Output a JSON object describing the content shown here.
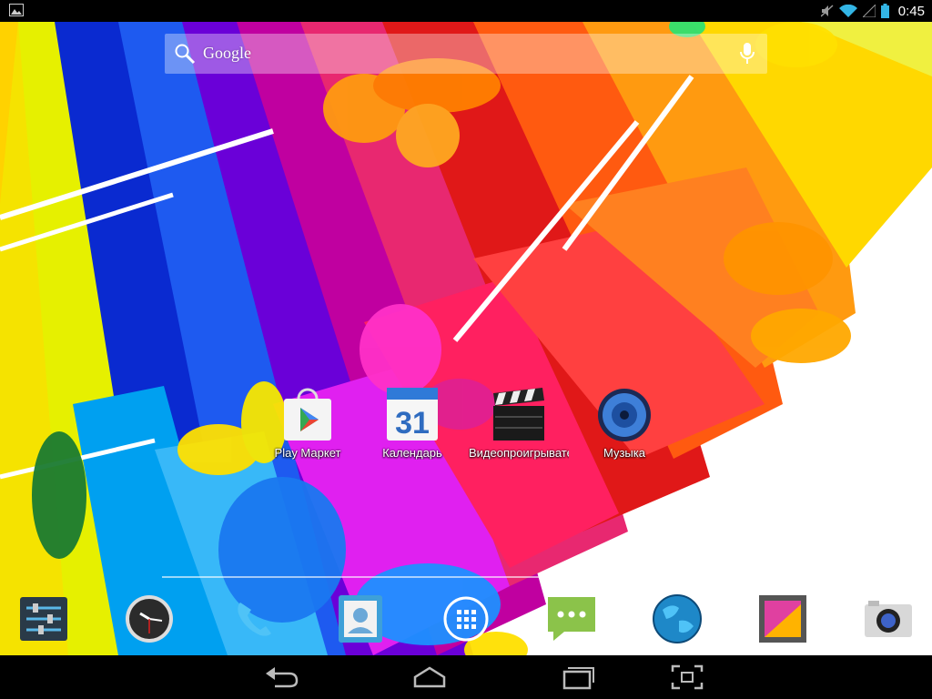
{
  "status_bar": {
    "time": "0:45",
    "icons": [
      "image-notification-icon",
      "mute-icon",
      "wifi-icon",
      "signal-icon",
      "battery-icon"
    ]
  },
  "search": {
    "placeholder": "Google",
    "icon": "search-icon",
    "voice_icon": "mic-icon"
  },
  "home_apps": [
    {
      "label": "Play Маркет",
      "icon": "play-store-icon"
    },
    {
      "label": "Календарь",
      "icon": "calendar-icon",
      "badge": "31"
    },
    {
      "label": "Видеопроигрыватель",
      "icon": "clapperboard-icon"
    },
    {
      "label": "Музыка",
      "icon": "speaker-icon"
    }
  ],
  "dock": [
    {
      "icon": "settings-icon"
    },
    {
      "icon": "clock-icon"
    },
    {
      "icon": "phone-icon"
    },
    {
      "icon": "contacts-icon"
    },
    {
      "icon": "app-drawer-icon"
    },
    {
      "icon": "messages-icon"
    },
    {
      "icon": "browser-globe-icon"
    },
    {
      "icon": "gallery-icon"
    },
    {
      "icon": "camera-icon"
    }
  ],
  "navigation": [
    "back-icon",
    "home-icon",
    "recent-apps-icon",
    "screenshot-icon"
  ],
  "colors": {
    "status_bar": "#000000",
    "nav_bar": "#000000",
    "wifi_accent": "#33b5e5",
    "label_text": "#ffffff"
  }
}
